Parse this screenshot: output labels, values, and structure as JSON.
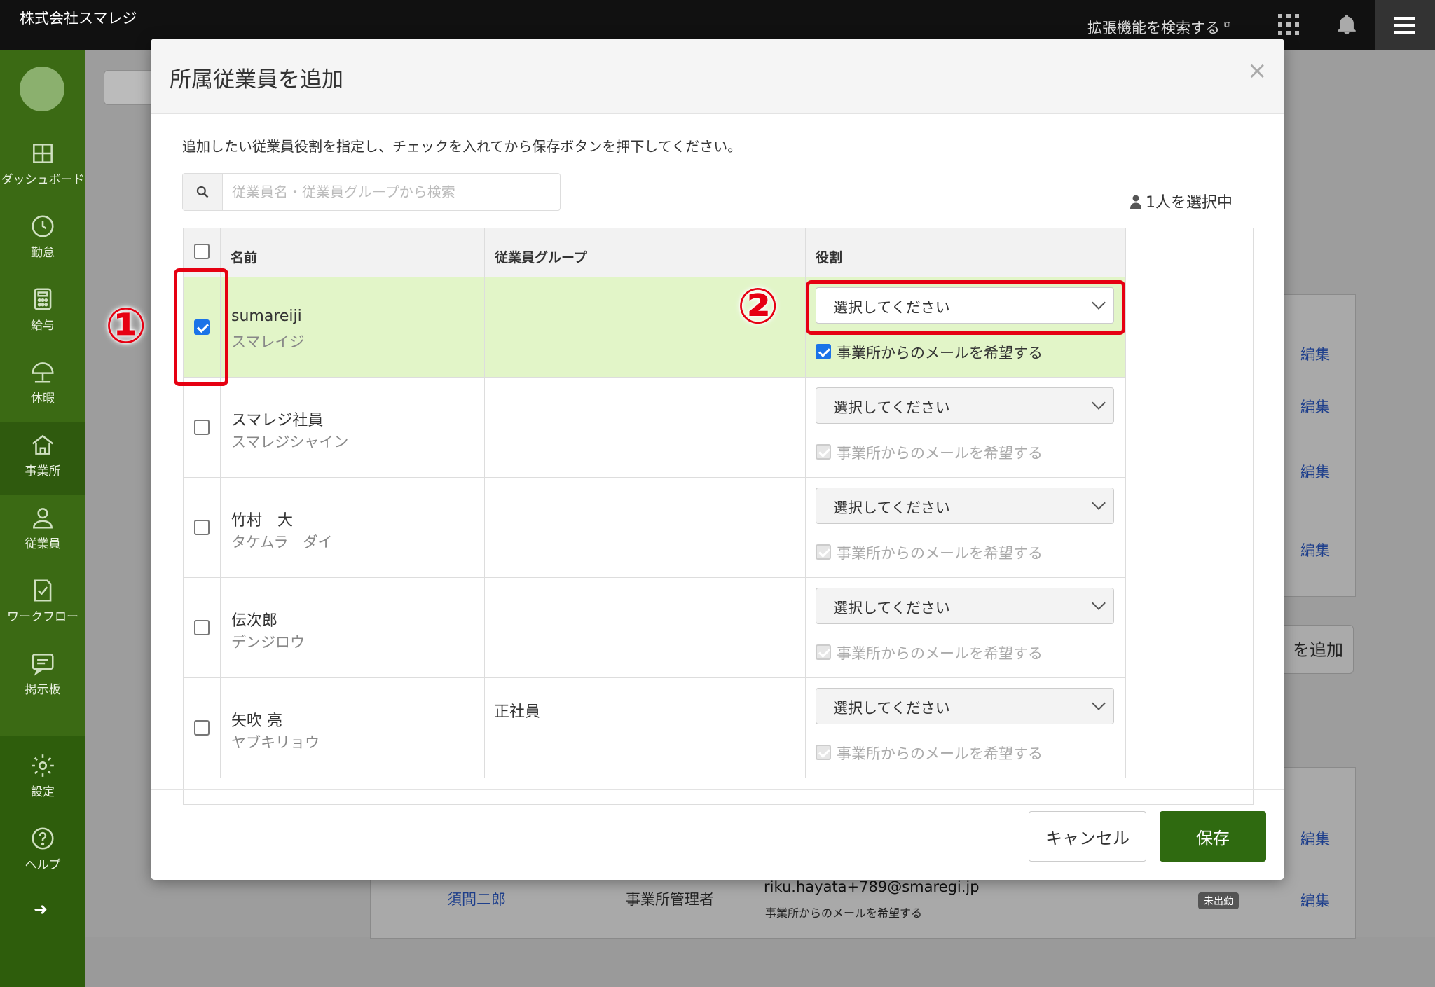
{
  "topbar": {
    "company": "株式会社スマレジ",
    "extension_search": "拡張機能を検索する",
    "ext_mark": "⧉"
  },
  "sidebar": {
    "items": [
      {
        "label": "ダッシュボード",
        "icon": "dashboard-icon"
      },
      {
        "label": "勤怠",
        "icon": "clock-icon"
      },
      {
        "label": "給与",
        "icon": "calculator-icon"
      },
      {
        "label": "休暇",
        "icon": "umbrella-icon"
      },
      {
        "label": "事業所",
        "icon": "home-icon"
      },
      {
        "label": "従業員",
        "icon": "person-icon"
      },
      {
        "label": "ワークフロー",
        "icon": "checklist-icon"
      },
      {
        "label": "掲示板",
        "icon": "message-icon"
      },
      {
        "label": "設定",
        "icon": "gear-icon"
      },
      {
        "label": "ヘルプ",
        "icon": "help-icon"
      }
    ],
    "active": "事業所",
    "arrow": "➜"
  },
  "background": {
    "edit_label": "編集",
    "add_button": "を追加",
    "row_name": "須間二郎",
    "row_role": "事業所管理者",
    "row_email": "riku.hayata+789@smaregi.jp",
    "row_email_sub": "事業所からのメールを希望する",
    "row_badge": "未出勤"
  },
  "modal": {
    "title": "所属従業員を追加",
    "close": "×",
    "instruction": "追加したい従業員役割を指定し、チェックを入れてから保存ボタンを押下してください。",
    "search_placeholder": "従業員名・従業員グループから検索",
    "selected_count": "1人を選択中",
    "columns": {
      "name": "名前",
      "group": "従業員グループ",
      "role": "役割"
    },
    "role_placeholder": "選択してください",
    "mail_label": "事業所からのメールを希望する",
    "rows": [
      {
        "name": "sumareiji",
        "kana": "スマレイジ",
        "group": "",
        "checked": true,
        "mail_checked": true,
        "mail_enabled": true
      },
      {
        "name": "スマレジ社員",
        "kana": "スマレジシャイン",
        "group": "",
        "checked": false,
        "mail_checked": true,
        "mail_enabled": false
      },
      {
        "name": "竹村　大",
        "kana": "タケムラ　ダイ",
        "group": "",
        "checked": false,
        "mail_checked": true,
        "mail_enabled": false
      },
      {
        "name": "伝次郎",
        "kana": "デンジロウ",
        "group": "",
        "checked": false,
        "mail_checked": true,
        "mail_enabled": false
      },
      {
        "name": "矢吹 亮",
        "kana": "ヤブキリョウ",
        "group": "正社員",
        "checked": false,
        "mail_checked": true,
        "mail_enabled": false
      }
    ],
    "cancel": "キャンセル",
    "save": "保存"
  },
  "annotations": {
    "one": "①",
    "two": "②",
    "color": "#e60012"
  }
}
